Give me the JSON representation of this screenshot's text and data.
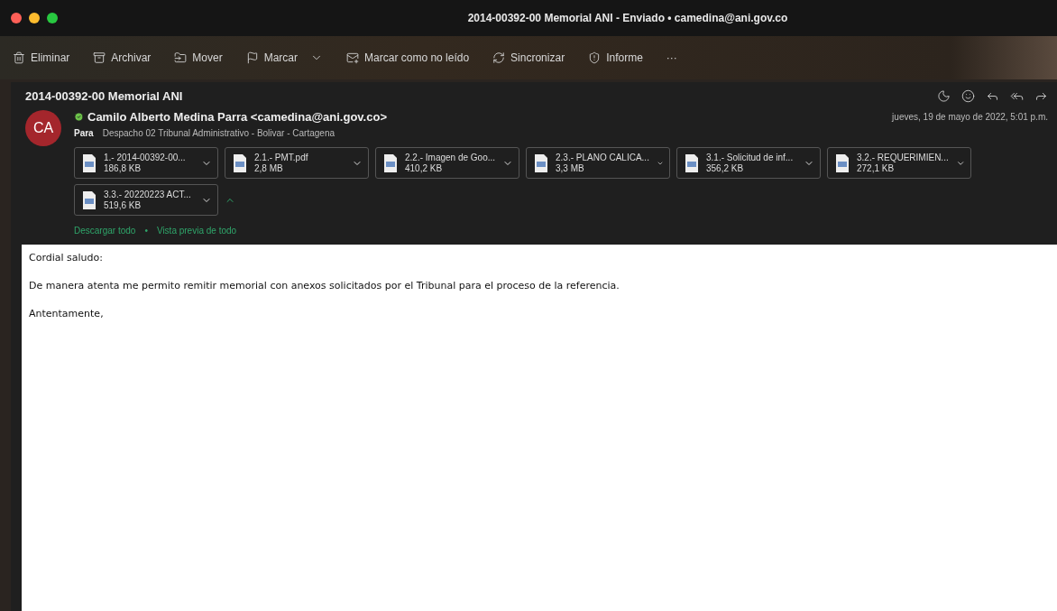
{
  "window": {
    "title": "2014-00392-00 Memorial ANI - Enviado • camedina@ani.gov.co"
  },
  "toolbar": [
    {
      "kind": "trash",
      "label": "Eliminar"
    },
    {
      "kind": "archive",
      "label": "Archivar"
    },
    {
      "kind": "move",
      "label": "Mover"
    },
    {
      "kind": "flag",
      "label": "Marcar"
    },
    {
      "kind": "unread",
      "label": "Marcar como no leído"
    },
    {
      "kind": "sync",
      "label": "Sincronizar"
    },
    {
      "kind": "report",
      "label": "Informe"
    },
    {
      "kind": "more",
      "label": "···"
    }
  ],
  "message": {
    "subject": "2014-00392-00 Memorial ANI",
    "avatar": "CA",
    "sender": "Camilo Alberto Medina Parra <camedina@ani.gov.co>",
    "date": "jueves, 19 de mayo de 2022, 5:01 p.m.",
    "to_label": "Para",
    "to": "Despacho 02 Tribunal Administrativo - Bolivar - Cartagena",
    "attachments": [
      {
        "name": "1.- 2014-00392-00...",
        "size": "186,8 KB"
      },
      {
        "name": "2.1.- PMT.pdf",
        "size": "2,8 MB"
      },
      {
        "name": "2.2.- Imagen de Goo...",
        "size": "410,2 KB"
      },
      {
        "name": "2.3.- PLANO CALICA...",
        "size": "3,3 MB"
      },
      {
        "name": "3.1.- Solicitud de inf...",
        "size": "356,2 KB"
      },
      {
        "name": "3.2.- REQUERIMIEN...",
        "size": "272,1 KB"
      },
      {
        "name": "3.3.- 20220223 ACT...",
        "size": "519,6 KB"
      }
    ],
    "links": [
      "Descargar todo",
      "Vista previa de todo"
    ],
    "link_separator": "•",
    "body": [
      "Cordial saludo:",
      "De manera atenta me permito remitir memorial con anexos solicitados por el Tribunal para el proceso de la referencia.",
      "Antentamente,"
    ]
  }
}
